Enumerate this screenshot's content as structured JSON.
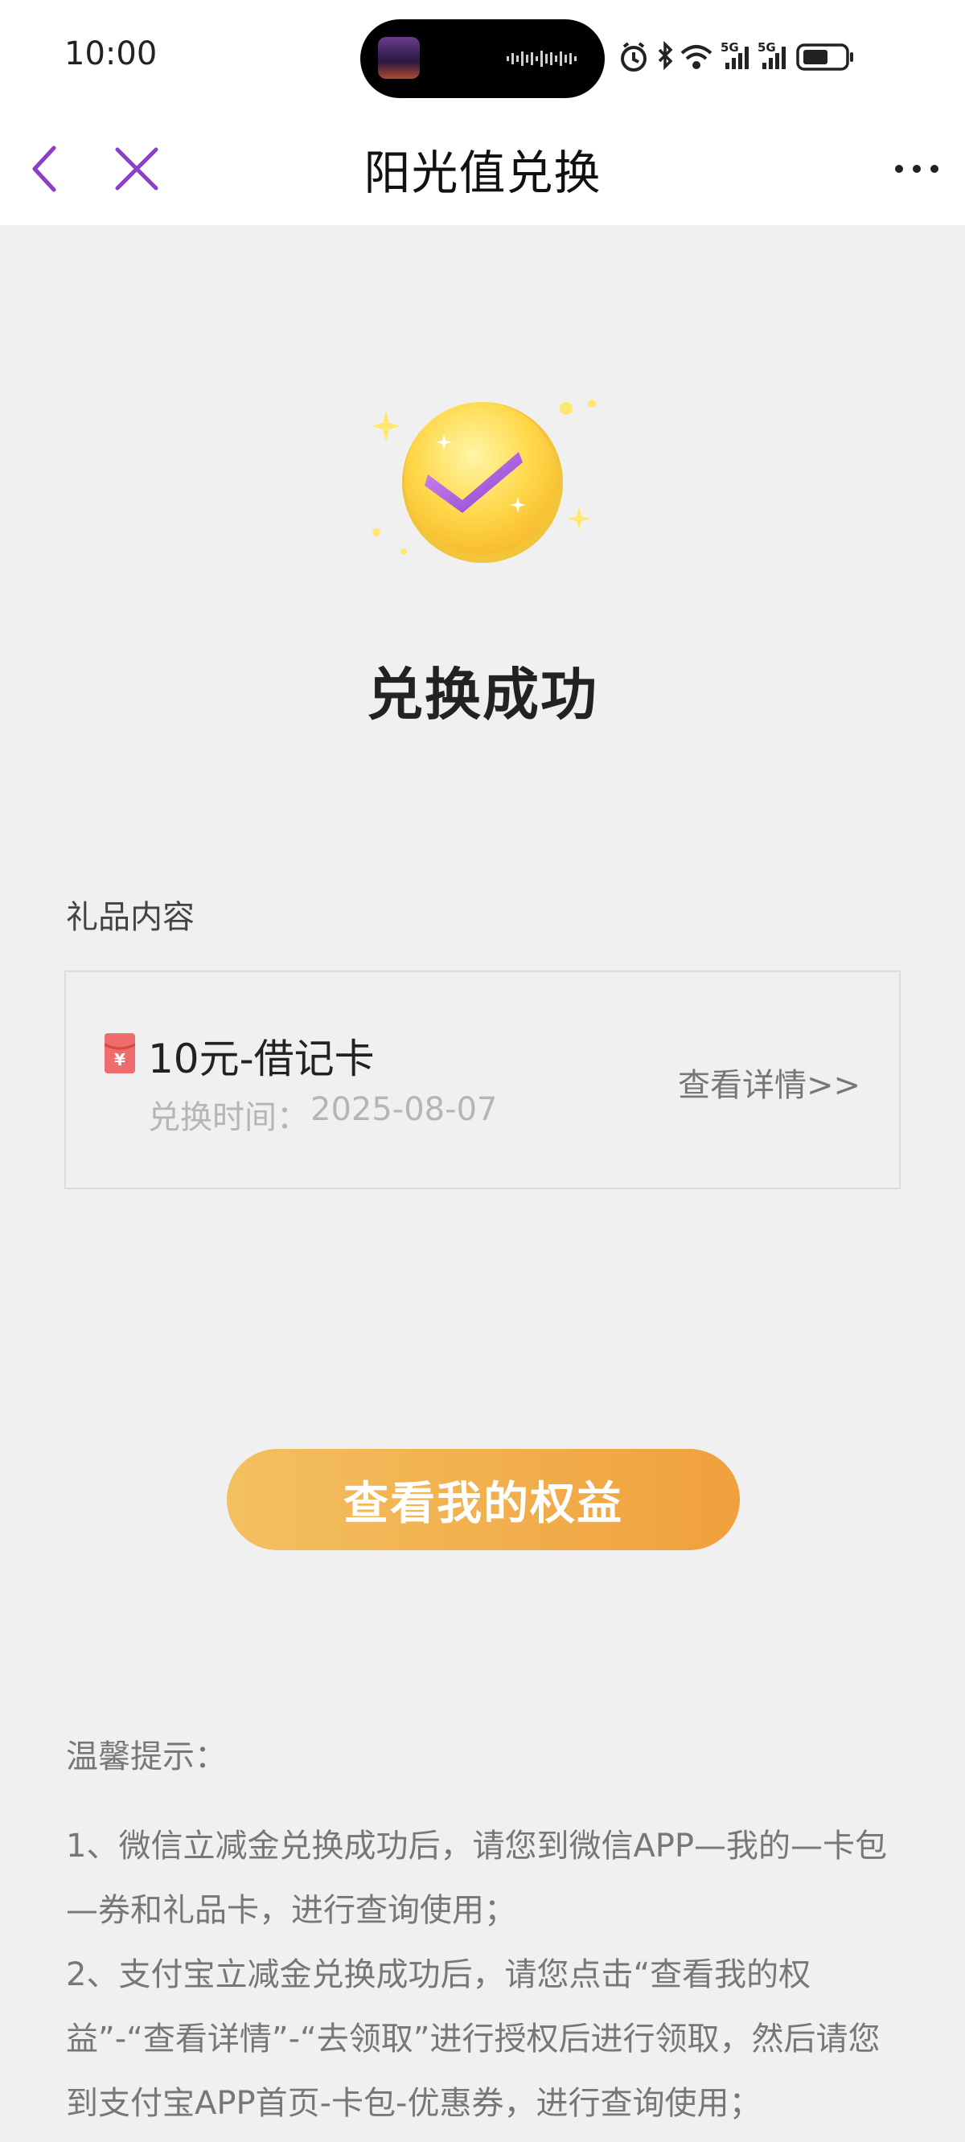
{
  "status_bar": {
    "time": "10:00",
    "icons": [
      "alarm-icon",
      "bluetooth-icon",
      "wifi-icon",
      "signal-5g-icon",
      "signal-5g-icon",
      "battery-icon"
    ],
    "network_labels": [
      "5G",
      "5G"
    ]
  },
  "nav": {
    "title": "阳光值兑换",
    "back_icon": "chevron-left-icon",
    "close_icon": "close-icon",
    "more_icon": "more-icon",
    "accent_color": "#8b3fc8"
  },
  "result": {
    "icon": "success-check-coin-icon",
    "title": "兑换成功"
  },
  "gift": {
    "section_label": "礼品内容",
    "icon": "red-packet-icon",
    "name": "10元-借记卡",
    "time_label": "兑换时间：",
    "time_value": "2025-08-07",
    "detail_link": "查看详情>>"
  },
  "actions": {
    "primary_button": "查看我的权益",
    "button_colors": [
      "#f3c060",
      "#f0a03c"
    ]
  },
  "tips": {
    "title": "温馨提示：",
    "items": [
      "1、微信立减金兑换成功后，请您到微信APP—我的—卡包—券和礼品卡，进行查询使用；",
      "2、支付宝立减金兑换成功后，请您点击“查看我的权益”-“查看详情”-“去领取”进行授权后进行领取，然后请您到支付宝APP首页-卡包-优惠券，进行查询使用；"
    ]
  }
}
